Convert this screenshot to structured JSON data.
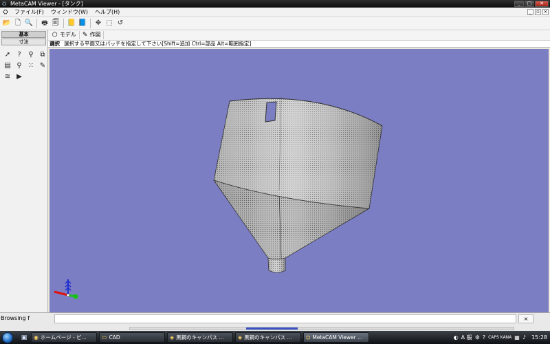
{
  "window": {
    "title": "MetaCAM Viewer - [タンク]",
    "controls": {
      "minimize": "_",
      "maximize": "□",
      "close": "✕"
    }
  },
  "menu": {
    "items": [
      "ファイル(F)",
      "ウィンドウ(W)",
      "ヘルプ(H)"
    ],
    "doc_controls": {
      "minimize": "_",
      "restore": "▫",
      "close": "×"
    }
  },
  "toolbar": {
    "buttons": [
      {
        "name": "open-icon",
        "glyph": "📂"
      },
      {
        "name": "new-file-icon",
        "glyph": "🗋"
      },
      {
        "name": "print-preview-icon",
        "glyph": "🔍"
      },
      {
        "name": "print-icon",
        "glyph": "🖶"
      },
      {
        "name": "page-preview-icon",
        "glyph": "🗐"
      },
      {
        "name": "properties-icon",
        "glyph": "📒"
      },
      {
        "name": "document-icon",
        "glyph": "📘"
      },
      {
        "name": "move-icon",
        "glyph": "✥"
      },
      {
        "name": "zoom-window-icon",
        "glyph": "⬚"
      },
      {
        "name": "rotate-view-icon",
        "glyph": "↺"
      }
    ]
  },
  "left_panel": {
    "tabs": [
      {
        "label": "基本",
        "active": true
      },
      {
        "label": "寸法",
        "active": false
      }
    ],
    "tools": [
      {
        "name": "select-arrow-icon",
        "glyph": "➚"
      },
      {
        "name": "query-icon",
        "glyph": "?"
      },
      {
        "name": "figure-icon",
        "glyph": "⚲"
      },
      {
        "name": "copy-icon",
        "glyph": "⧉"
      },
      {
        "name": "layer-icon",
        "glyph": "▤"
      },
      {
        "name": "magnify-icon",
        "glyph": "⚲"
      },
      {
        "name": "grid-points-icon",
        "glyph": "⁙"
      },
      {
        "name": "note-icon",
        "glyph": "✎"
      },
      {
        "name": "stack-icon",
        "glyph": "≋"
      },
      {
        "name": "play-icon",
        "glyph": "▶"
      }
    ]
  },
  "view_tabs": [
    {
      "label": "モデル",
      "icon": "cube-icon",
      "glyph": "⬡"
    },
    {
      "label": "作図",
      "icon": "drafting-icon",
      "glyph": "✎"
    }
  ],
  "prompt": {
    "mode": "選択",
    "message": "選択する平面又はパッチを指定して下さい[Shift=追加 Ctrl=部品 Alt=範囲指定]"
  },
  "viewport": {
    "background": "#7b7ec2",
    "model_color": "#c9c9c9",
    "axis_colors": {
      "x": "#e01010",
      "y": "#18c018",
      "z": "#2030d0"
    }
  },
  "browser": {
    "label": "Browsing f",
    "close_label": "×",
    "scroll_position": 0.35
  },
  "taskbar": {
    "tasks": [
      {
        "label": "ホームページ - ビ...",
        "active": false
      },
      {
        "label": "CAD",
        "active": false
      },
      {
        "label": "黒鋼のキャンパス ...",
        "active": false
      },
      {
        "label": "黒鋼のキャンパス ...",
        "active": false
      },
      {
        "label": "MetaCAM Viewer ...",
        "active": true
      }
    ],
    "tray": {
      "lang_mode": "A 般",
      "caps": "CAPS KANA",
      "clock": "15:28"
    }
  }
}
